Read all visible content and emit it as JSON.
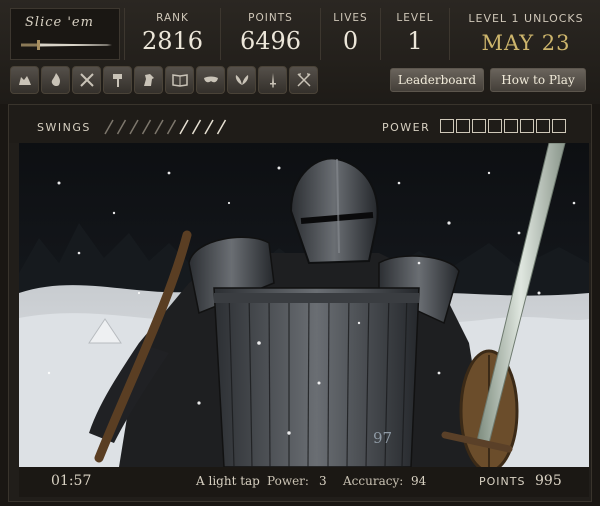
{
  "header": {
    "logo_text": "Slice 'em",
    "stats": {
      "rank_label": "RANK",
      "rank_value": "2816",
      "points_label": "POINTS",
      "points_value": "6496",
      "lives_label": "LIVES",
      "lives_value": "0",
      "level_label": "LEVEL",
      "level_value": "1"
    },
    "unlock": {
      "label": "LEVEL 1 UNLOCKS",
      "date": "MAY 23"
    },
    "icons": [
      "wolf-icon",
      "flame-icon",
      "crossed-swords-icon",
      "hammer-icon",
      "horse-icon",
      "book-icon",
      "mask-icon",
      "wings-icon",
      "sword-icon",
      "crossed-axes-icon"
    ],
    "buttons": {
      "leaderboard": "Leaderboard",
      "how_to_play": "How to Play"
    }
  },
  "game": {
    "swings_label": "SWINGS",
    "swings_total": 10,
    "swings_used": 6,
    "power_label": "POWER",
    "power_boxes": 8,
    "power_filled": 0,
    "hit_value": "97"
  },
  "status": {
    "timer": "01:57",
    "message": "A light tap",
    "power_label": "Power:",
    "power_value": "3",
    "accuracy_label": "Accuracy:",
    "accuracy_value": "94",
    "points_label": "POINTS",
    "points_value": "995"
  },
  "colors": {
    "accent_gold": "#cdb56c",
    "panel": "#2b2722"
  }
}
